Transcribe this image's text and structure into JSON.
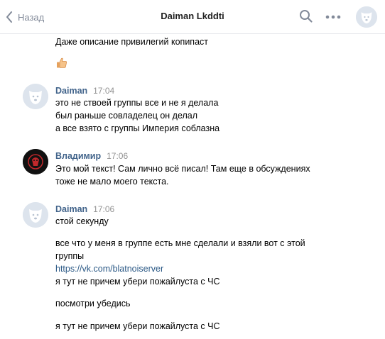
{
  "header": {
    "back_label": "Назад",
    "title": "Daiman Lkddti"
  },
  "colors": {
    "sender_name": "#42648b",
    "link": "#2a5885",
    "timestamp": "#939393",
    "avatar_bg": "#dde4ed"
  },
  "messages": {
    "m0": {
      "line1": "Даже описание привилегий копипаст",
      "emoji_icon": "thumbs-up-emoji"
    },
    "m1": {
      "sender": "Daiman",
      "time": "17:04",
      "line1": "это не ствоей группы все и не я делала",
      "line2": "был раньше совладелец он делал",
      "line3": "а все взято с группы Империя соблазна"
    },
    "m2": {
      "sender": "Владимир",
      "time": "17:06",
      "line1": "Это мой текст! Сам лично всё писал! Там еще в обсуждениях",
      "line2": "тоже не мало моего текста."
    },
    "m3": {
      "sender": "Daiman",
      "time": "17:06",
      "line1": "стой секунду",
      "line2": "все что у меня в группе есть мне сделали и взяли вот с этой",
      "line3": "группы",
      "link": "https://vk.com/blatnoiserver",
      "line4": "я тут не причем убери пожайлуста с ЧС",
      "line5": "посмотри убедись",
      "line6": "я тут не причем убери пожайлуста с ЧС"
    }
  }
}
